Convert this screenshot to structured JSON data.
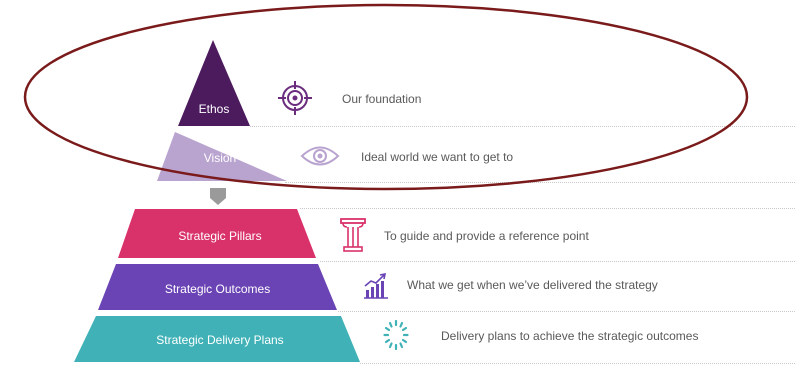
{
  "pyramid": {
    "layers": [
      {
        "label": "Ethos",
        "color": "#4b1b5e"
      },
      {
        "label": "Vision",
        "color": "#b9a3cf"
      },
      {
        "label": "Strategic Pillars",
        "color": "#d9326a"
      },
      {
        "label": "Strategic Outcomes",
        "color": "#6a44b5"
      },
      {
        "label": "Strategic Delivery Plans",
        "color": "#40b2b7"
      }
    ]
  },
  "descriptions": [
    {
      "text": "Our foundation",
      "icon": "target-icon"
    },
    {
      "text": "Ideal world we want to get to",
      "icon": "eye-icon"
    },
    {
      "text": "To guide and provide a reference point",
      "icon": "pillar-icon"
    },
    {
      "text": "What we get when we’ve delivered the strategy",
      "icon": "growth-chart-icon"
    },
    {
      "text": "Delivery plans to achieve the strategic outcomes",
      "icon": "dotted-circle-icon"
    }
  ],
  "colors": {
    "highlight_ellipse": "#7a1a1a",
    "connector": "#9a9a9a",
    "text": "#595959"
  }
}
